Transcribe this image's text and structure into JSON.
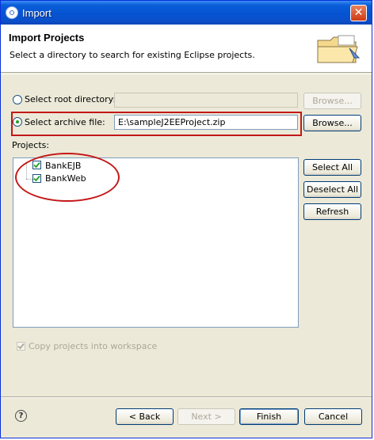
{
  "window": {
    "title": "Import",
    "close_glyph": "✕"
  },
  "header": {
    "title": "Import Projects",
    "description": "Select a directory to search for existing Eclipse projects."
  },
  "source": {
    "root_dir_label": "Select root directory:",
    "root_dir_value": "",
    "root_browse": "Browse...",
    "archive_label": "Select archive file:",
    "archive_value": "E:\\sampleJ2EEProject.zip",
    "archive_browse": "Browse...",
    "selected_option": "archive"
  },
  "projects": {
    "label": "Projects:",
    "items": [
      {
        "name": "BankEJB",
        "checked": true
      },
      {
        "name": "BankWeb",
        "checked": true
      }
    ],
    "select_all": "Select All",
    "deselect_all": "Deselect All",
    "refresh": "Refresh"
  },
  "options": {
    "copy_label": "Copy projects into workspace",
    "copy_checked": true,
    "copy_enabled": false
  },
  "footer": {
    "help_glyph": "?",
    "back": "< Back",
    "next": "Next >",
    "finish": "Finish",
    "cancel": "Cancel"
  },
  "annotations": {
    "color": "#c31818"
  }
}
